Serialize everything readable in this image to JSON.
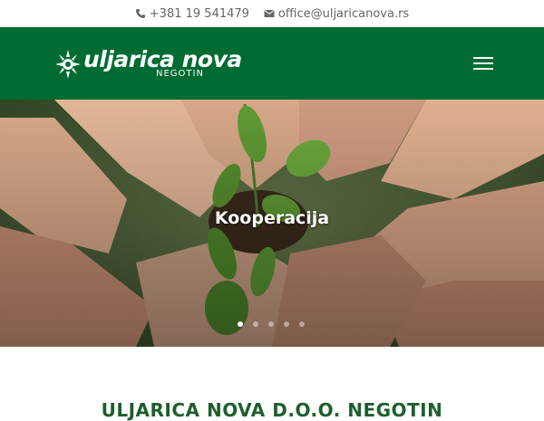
{
  "topbar": {
    "phone": "+381 19 541479",
    "email": "office@uljaricanova.rs"
  },
  "header": {
    "logo_brand": "uljarica nova",
    "logo_sub": "NEGOTIN",
    "menu_icon": "hamburger-menu-icon"
  },
  "hero": {
    "slide_title": "Kooperacija",
    "slide_count": 5,
    "active_slide": 1
  },
  "section": {
    "title": "ULJARICA NOVA D.O.O. NEGOTIN"
  },
  "colors": {
    "header_bg": "#006b32",
    "topbar_text": "#666666",
    "section_title": "#1e5e2e"
  }
}
